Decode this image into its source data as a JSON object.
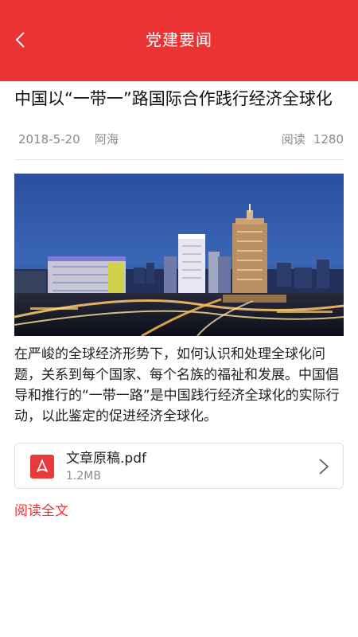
{
  "header": {
    "title": "党建要闻",
    "back_icon": "chevron-left-icon",
    "background": "#ec3333"
  },
  "article": {
    "title": "中国以“一带一”路国际合作践行经济全球化",
    "date": "2018-5-20",
    "author": "阿海",
    "read_label": "阅读",
    "read_count": "1280",
    "body": "在严峻的全球经济形势下，如何认识和处理全球化问题，关系到每个国家、每个名族的福祉和发展。中国倡导和推行的“一带一路”是中国践行经济全球化的实际行动，以此鉴定的促进经济全球化。"
  },
  "attachment": {
    "file_name": "文章原稿.pdf",
    "file_size": "1.2MB",
    "icon": "pdf-icon",
    "arrow_icon": "chevron-right-icon"
  },
  "footer": {
    "read_full_label": "阅读全文",
    "accent": "#ec3333"
  }
}
